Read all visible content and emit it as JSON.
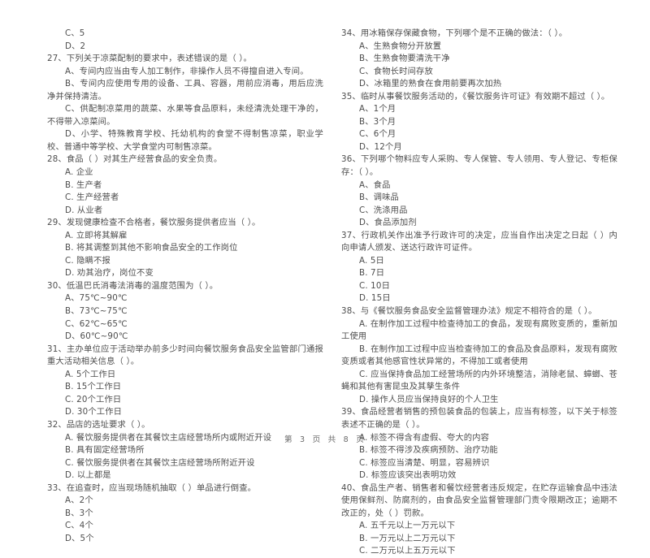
{
  "document": {
    "footer": "第 3 页 共 8 页",
    "page_number": "3",
    "total_pages": "8"
  },
  "left_column": {
    "orphan_options": [
      "C、5",
      "D、2"
    ],
    "questions": [
      {
        "number": "27",
        "stem": "27、下列关于凉菜配制的要求中，表述错误的是（    ）。",
        "options": [
          "A、专间内应当由专人加工制作，非操作人员不得擅自进入专间。",
          "B、专间内应使用专用的设备、工具、容器，用前应消毒，用后应洗净并保持清洁。",
          "C、供配制凉菜用的蔬菜、水果等食品原料，未经清洗处理干净的，不得带入凉菜间。",
          "D、小学、特殊教育学校、托幼机构的食堂不得制售凉菜，职业学校、普通中等学校、大学食堂内可制售凉菜。"
        ]
      },
      {
        "number": "28",
        "stem": "28、食品（    ）对其生产经营食品的安全负责。",
        "options": [
          "A. 企业",
          "B. 生产者",
          "C. 生产经营者",
          "D. 从业者"
        ]
      },
      {
        "number": "29",
        "stem": "29、发现健康检查不合格者，餐饮服务提供者应当（    ）。",
        "options": [
          "A. 立即将其解雇",
          "B. 将其调整到其他不影响食品安全的工作岗位",
          "C. 隐瞒不报",
          "D. 劝其治疗，岗位不变"
        ]
      },
      {
        "number": "30",
        "stem": "30、低温巴氏消毒法消毒的温度范围为（    ）。",
        "options": [
          "A、75℃~90℃",
          "B、73℃~75℃",
          "C、62℃~65℃",
          "D、60℃~90℃"
        ]
      },
      {
        "number": "31",
        "stem": "31、主办单位应于活动举办前多少时间向餐饮服务食品安全监管部门通报重大活动相关信息（    ）。",
        "options": [
          "A. 5个工作日",
          "B. 15个工作日",
          "C. 20个工作日",
          "D. 30个工作日"
        ]
      },
      {
        "number": "32",
        "stem": "32、品店的选址要求（    ）。",
        "options": [
          "A. 餐饮服务提供者在其餐饮主店经营场所内或附近开设",
          "B. 具有固定经营场所",
          "C. 餐饮服务提供者在其餐饮主店经营场所附近开设",
          "D. 以上都是"
        ]
      },
      {
        "number": "33",
        "stem": "33、在追查时，应当现场随机抽取（    ）单品进行倒查。",
        "options": [
          "A、2个",
          "B、3个",
          "C、4个",
          "D、5个"
        ]
      }
    ]
  },
  "right_column": {
    "questions": [
      {
        "number": "34",
        "stem": "34、用冰箱保存保藏食物，下列哪个是不正确的做法：（    ）。",
        "options": [
          "A、生熟食物分开放置",
          "B、生熟食物要清洗干净",
          "C、食物长时间存放",
          "D、冰箱里的熟食在食用前要再次加热"
        ]
      },
      {
        "number": "35",
        "stem": "35、临时从事餐饮服务活动的，《餐饮服务许可证》有效期不超过（    ）。",
        "options": [
          "A、1个月",
          "B、3个月",
          "C、6个月",
          "D、12个月"
        ]
      },
      {
        "number": "36",
        "stem": "36、下列哪个物料应专人采购、专人保管、专人领用、专人登记、专柜保存：（    ）。",
        "options": [
          "A、食品",
          "B、调味品",
          "C、洗涤用品",
          "D、食品添加剂"
        ]
      },
      {
        "number": "37",
        "stem": "37、行政机关作出准予行政许可的决定，应当自作出决定之日起（    ）内向申请人颁发、送达行政许可证件。",
        "options": [
          "A. 5日",
          "B. 7日",
          "C. 10日",
          "D. 15日"
        ]
      },
      {
        "number": "38",
        "stem": "38、与《餐饮服务食品安全监督管理办法》规定不相符合的是（    ）。",
        "options": [
          "A. 在制作加工过程中检查待加工的食品，发现有腐败变质的，重新加工使用",
          "B. 在制作加工过程中应当检查待加工的食品及食品原料，发现有腐败变质或者其他感官性状异常的，不得加工或者使用",
          "C. 应当保持食品加工经营场所的内外环境整洁，消除老鼠、蟑螂、苍蝇和其他有害昆虫及其孳生条件",
          "D. 操作人员应当保持良好的个人卫生"
        ]
      },
      {
        "number": "39",
        "stem": "39、食品经营者销售的预包装食品的包装上，应当有标签，以下关于标签表述不正确的是（    ）。",
        "options": [
          "A. 标签不得含有虚假、夸大的内容",
          "B. 标签不得涉及疾病预防、治疗功能",
          "C. 标签应当清楚、明显，容易辨识",
          "D. 标签应该突出表明功效"
        ]
      },
      {
        "number": "40",
        "stem": "40、食品生产者、销售者和餐饮经营者违反规定，在贮存运输食品中违法使用保鲜剂、防腐剂的，由食品安全监督管理部门责令限期改正；逾期不改正的，处（    ）罚款。",
        "options": [
          "A. 五千元以上一万元以下",
          "B. 一万元以上二万元以下",
          "C. 二万元以上五万元以下"
        ]
      }
    ]
  }
}
